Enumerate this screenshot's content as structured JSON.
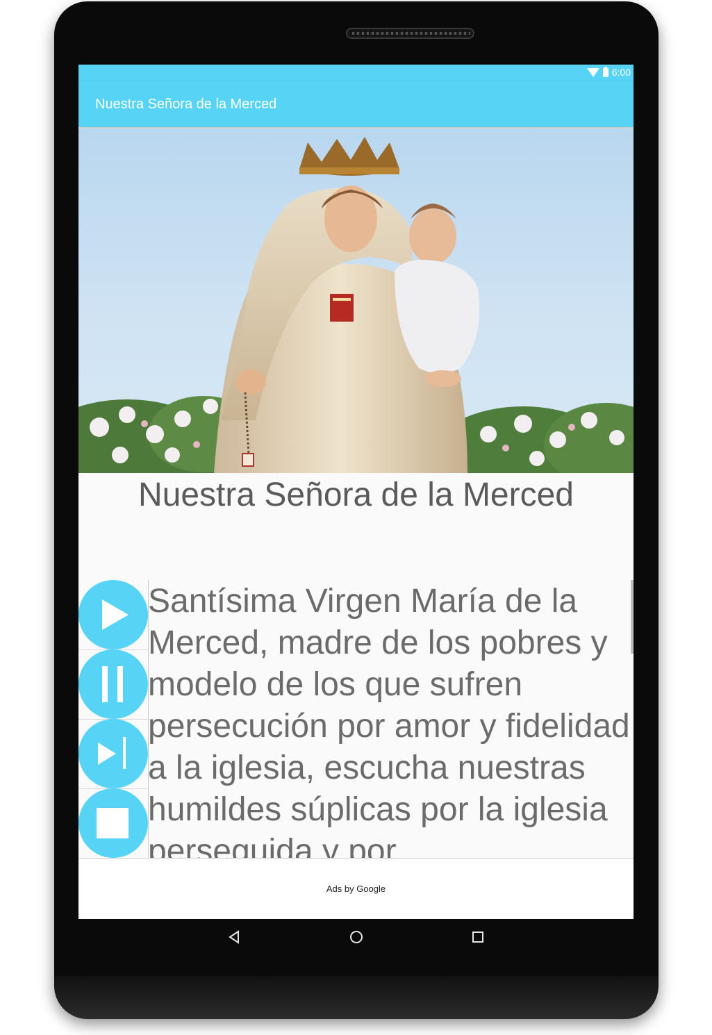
{
  "status_bar": {
    "time": "6:00",
    "wifi_icon": "wifi-icon",
    "battery_icon": "battery-icon"
  },
  "app_bar": {
    "title": "Nuestra Señora de la Merced"
  },
  "hero": {
    "image": "statue of Our Lady of Mercy holding the Child Jesus, with a rosary, above white roses"
  },
  "content": {
    "title": "Nuestra Señora de la Merced",
    "prayer": "Santísima Virgen María de la Merced, madre de los pobres y modelo de los que sufren persecución por amor y fidelidad a la iglesia, escucha nuestras humildes súplicas por la iglesia perseguida y por"
  },
  "player": {
    "buttons": [
      {
        "icon": "play-icon"
      },
      {
        "icon": "pause-icon"
      },
      {
        "icon": "skip-next-icon"
      },
      {
        "icon": "stop-icon"
      }
    ]
  },
  "ad": {
    "label": "Ads by Google"
  },
  "nav_bar": {
    "buttons": [
      "back-icon",
      "home-icon",
      "recents-icon"
    ]
  },
  "colors": {
    "accent": "#56d3f5",
    "text": "#6b6b6b",
    "device": "#0a0a0a"
  }
}
